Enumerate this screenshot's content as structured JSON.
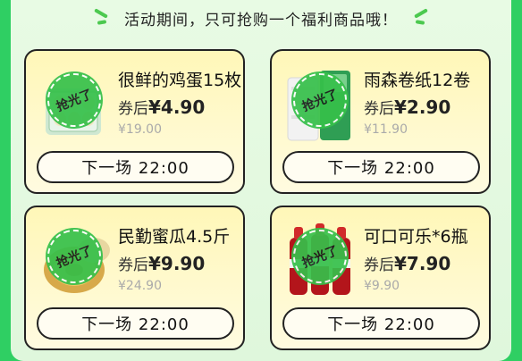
{
  "header": {
    "notice": "活动期间，只可抢购一个福利商品哦！"
  },
  "stamp_text": "抢光了",
  "products": [
    {
      "name": "很鲜的鸡蛋15枚",
      "price_label": "券后",
      "price": "¥4.90",
      "original": "¥19.00",
      "button": "下一场 22:00",
      "thumb": "egg-box-image"
    },
    {
      "name": "雨森卷纸12卷",
      "price_label": "券后",
      "price": "¥2.90",
      "original": "¥11.90",
      "button": "下一场 22:00",
      "thumb": "tissue-roll-image"
    },
    {
      "name": "民勤蜜瓜4.5斤",
      "price_label": "券后",
      "price": "¥9.90",
      "original": "¥24.90",
      "button": "下一场 22:00",
      "thumb": "melon-image"
    },
    {
      "name": "可口可乐*6瓶",
      "price_label": "券后",
      "price": "¥7.90",
      "original": "¥9.90",
      "button": "下一场 22:00",
      "thumb": "cola-bottles-image"
    }
  ],
  "colors": {
    "accent_green": "#2fcf63",
    "card_yellow": "#fff7b8",
    "stamp_green": "#36c04a"
  }
}
